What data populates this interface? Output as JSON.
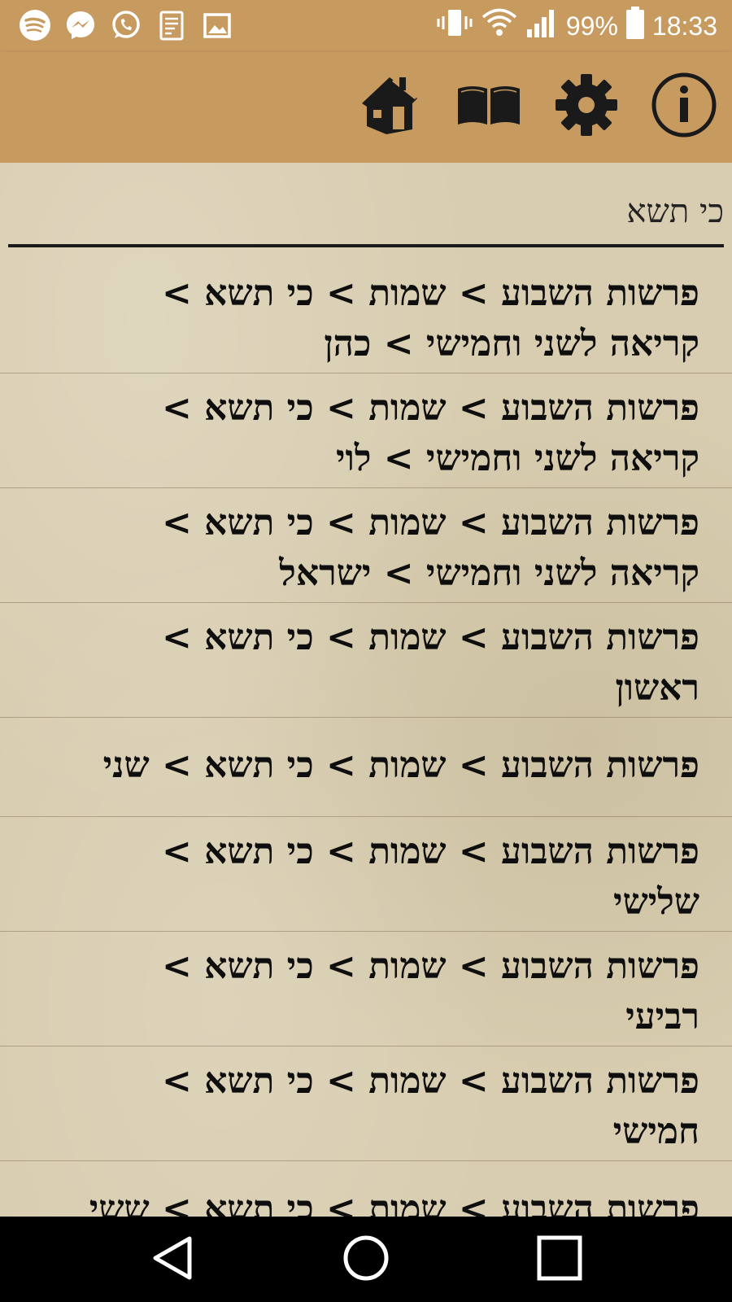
{
  "status_bar": {
    "battery": "99%",
    "time": "18:33",
    "icons": [
      "spotify-icon",
      "messenger-icon",
      "whatsapp-icon",
      "notes-icon",
      "gallery-icon",
      "vibrate-icon",
      "wifi-icon",
      "signal-icon",
      "battery-icon"
    ]
  },
  "toolbar": {
    "icons": [
      "home-icon",
      "book-icon",
      "gear-icon",
      "info-icon"
    ]
  },
  "search": {
    "value": "כי תשא"
  },
  "results": [
    {
      "line1": "פרשות השבוע > שמות > כי תשא >",
      "line2": "קריאה לשני וחמישי > כהן"
    },
    {
      "line1": "פרשות השבוע > שמות > כי תשא >",
      "line2": "קריאה לשני וחמישי > לוי"
    },
    {
      "line1": "פרשות השבוע > שמות > כי תשא >",
      "line2": "קריאה לשני וחמישי > ישראל"
    },
    {
      "line1": "פרשות השבוע > שמות > כי תשא >",
      "line2": "ראשון"
    },
    {
      "line1": "פרשות השבוע > שמות > כי תשא > שני"
    },
    {
      "line1": "פרשות השבוע > שמות > כי תשא >",
      "line2": "שלישי"
    },
    {
      "line1": "פרשות השבוע > שמות > כי תשא >",
      "line2": "רביעי"
    },
    {
      "line1": "פרשות השבוע > שמות > כי תשא >",
      "line2": "חמישי"
    },
    {
      "line1": "פרשות השבוע > שמות > כי תשא > ששי"
    }
  ],
  "colors": {
    "bar": "#c79a60",
    "paper": "#d8cdb0",
    "text": "#0e0e0e",
    "nav": "#000000"
  }
}
